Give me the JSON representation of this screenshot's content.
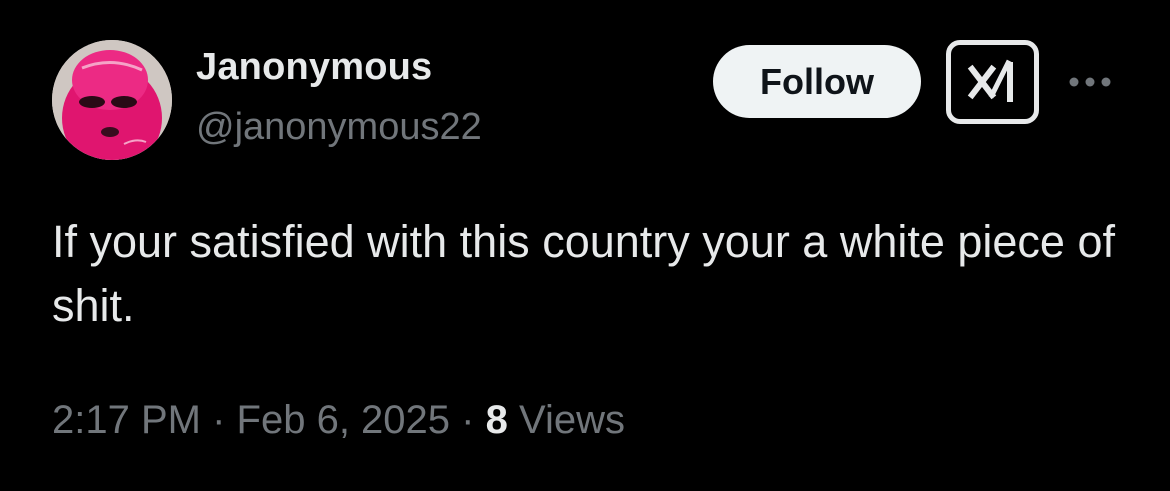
{
  "author": {
    "display_name": "Janonymous",
    "handle": "@janonymous22",
    "avatar_icon": "avatar-pink-ski-mask"
  },
  "actions": {
    "follow_label": "Follow",
    "grok_icon": "grok-icon",
    "more_icon": "more-icon"
  },
  "tweet": {
    "text": "If your satisfied with this country your a white piece of shit."
  },
  "meta": {
    "time": "2:17 PM",
    "separator": "·",
    "date": "Feb 6, 2025",
    "views_count": "8",
    "views_label": "Views"
  },
  "colors": {
    "background": "#000000",
    "primary_text": "#e7e9ea",
    "secondary_text": "#71767b",
    "follow_bg": "#eff3f4",
    "follow_text": "#0f1419"
  }
}
